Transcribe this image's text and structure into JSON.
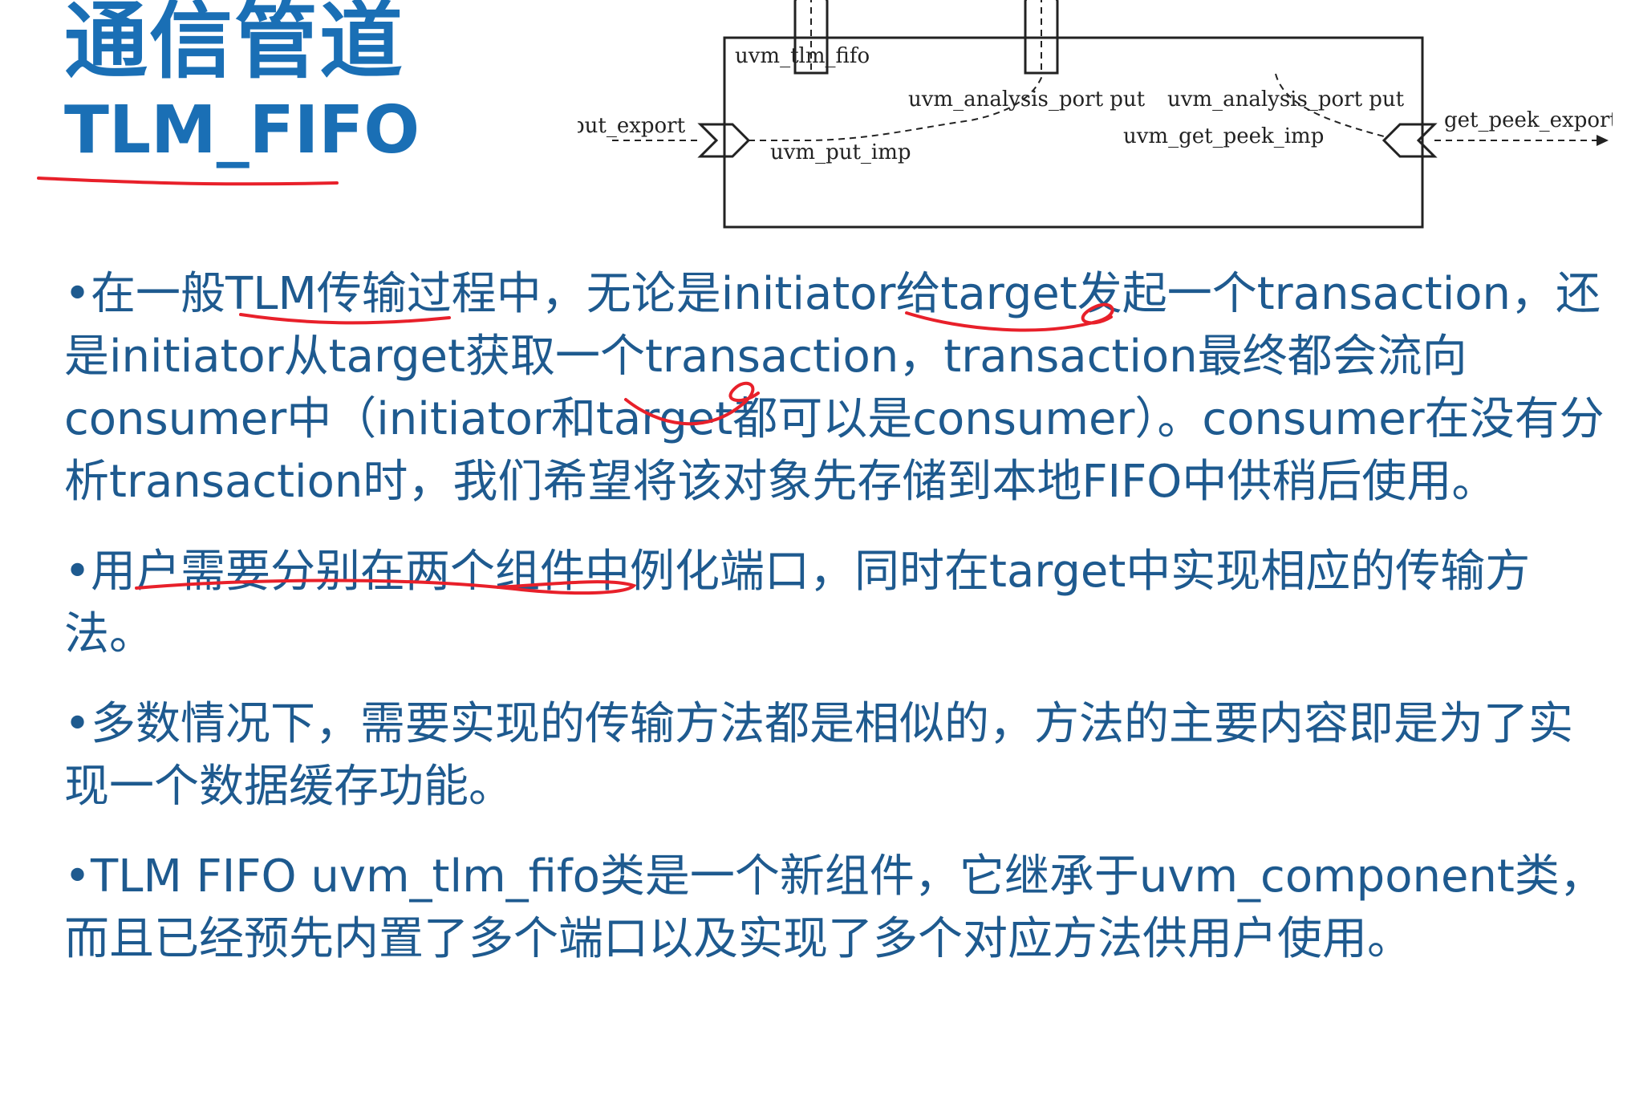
{
  "title": {
    "main": "通信管道",
    "sub": "TLM_FIFO"
  },
  "diagram": {
    "box_label": "uvm_tlm_fifo",
    "put_export": "put_export",
    "put_imp": "uvm_put_imp",
    "analysis_port_1": "uvm_analysis_port put",
    "analysis_port_2": "uvm_analysis_port put",
    "get_peek_imp": "uvm_get_peek_imp",
    "get_peek_export": "get_peek_export"
  },
  "bullets": [
    {
      "marker": "•",
      "text": "在一般TLM传输过程中，无论是initiator给target发起一个transaction，还是initiator从target获取一个transaction，transaction最终都会流向consumer中（initiator和target都可以是consumer）。consumer在没有分析transaction时，我们希望将该对象先存储到本地FIFO中供稍后使用。"
    },
    {
      "marker": "•",
      "text": "用户需要分别在两个组件中例化端口，同时在target中实现相应的传输方法。"
    },
    {
      "marker": "•",
      "text": "多数情况下，需要实现的传输方法都是相似的，方法的主要内容即是为了实现一个数据缓存功能。"
    },
    {
      "marker": "•",
      "text": "TLM FIFO uvm_tlm_fifo类是一个新组件，它继承于uvm_component类，而且已经预先内置了多个端口以及实现了多个对应方法供用户使用。"
    }
  ],
  "colors": {
    "title": "#1a6fb5",
    "body_text": "#1e5a8f",
    "annotation": "#e8202a"
  }
}
